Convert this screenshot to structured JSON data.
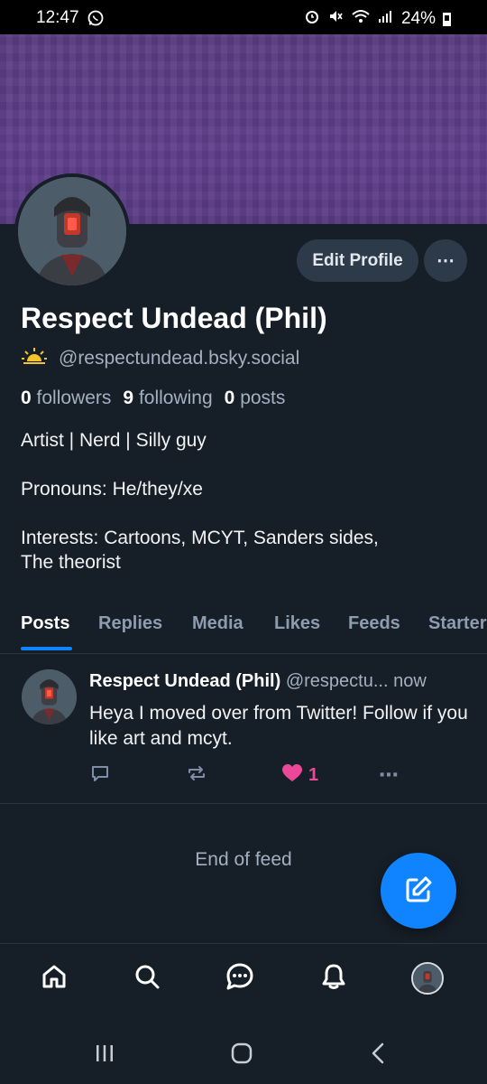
{
  "status_bar": {
    "time": "12:47",
    "battery": "24%"
  },
  "profile": {
    "display_name": "Respect Undead (Phil)",
    "handle": "@respectundead.bsky.social",
    "edit_button": "Edit Profile",
    "more_button": "⋯",
    "followers_count": "0",
    "followers_label": "followers",
    "following_count": "9",
    "following_label": "following",
    "posts_count": "0",
    "posts_label": "posts",
    "bio": [
      "Artist | Nerd | Silly guy",
      "Pronouns: He/they/xe",
      "Interests: Cartoons, MCYT, Sanders sides,",
      "The theorist"
    ]
  },
  "tabs": [
    {
      "label": "Posts",
      "active": true
    },
    {
      "label": "Replies",
      "active": false
    },
    {
      "label": "Media",
      "active": false
    },
    {
      "label": "Likes",
      "active": false
    },
    {
      "label": "Feeds",
      "active": false
    },
    {
      "label": "Starter",
      "active": false
    }
  ],
  "post": {
    "author": "Respect Undead (Phil)",
    "handle_truncated": "@respectu...",
    "time": "now",
    "text": "Heya I moved over from Twitter! Follow if you like art and mcyt.",
    "like_count": "1",
    "more": "⋯"
  },
  "feed_end": "End of feed",
  "colors": {
    "background": "#161e27",
    "accent": "#1083fe",
    "banner": "#5e3e88",
    "like": "#ec4899",
    "muted": "#a2b0c0"
  },
  "icons": {
    "nav": [
      "home-icon",
      "search-icon",
      "chat-icon",
      "bell-icon",
      "profile-avatar"
    ],
    "post_actions": [
      "reply-icon",
      "repost-icon",
      "heart-icon",
      "more-icon"
    ],
    "fab": "compose-icon"
  }
}
